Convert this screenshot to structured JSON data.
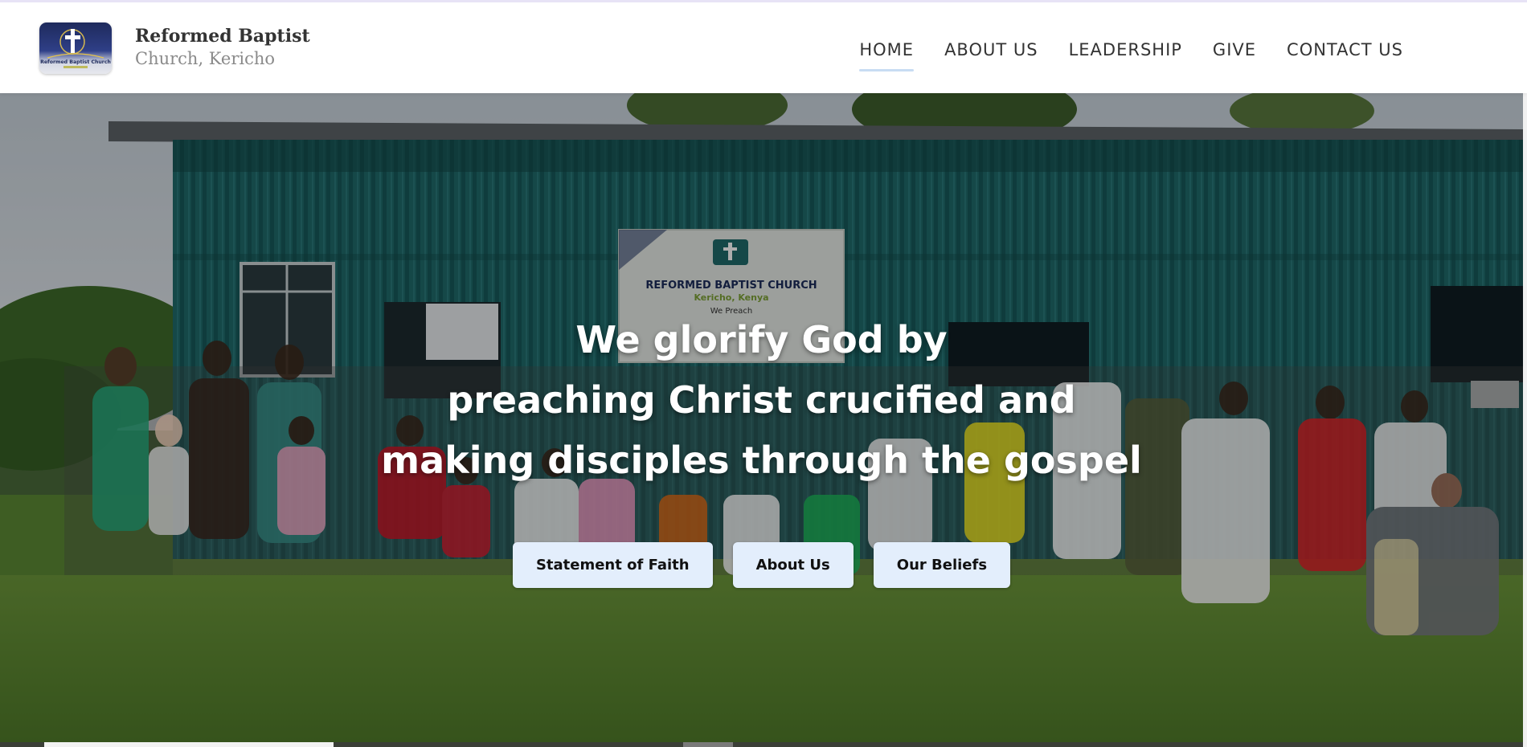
{
  "header": {
    "logo": {
      "icon": "cross-icon",
      "text": "Reformed Baptist Church"
    },
    "brand": {
      "line1": "Reformed Baptist",
      "line2": "Church, Kericho"
    },
    "nav": [
      {
        "label": "HOME",
        "active": true
      },
      {
        "label": "ABOUT US",
        "active": false
      },
      {
        "label": "LEADERSHIP",
        "active": false
      },
      {
        "label": "GIVE",
        "active": false
      },
      {
        "label": "CONTACT US",
        "active": false
      }
    ]
  },
  "hero": {
    "heading_lines": [
      "We glorify God by",
      "preaching Christ crucified and",
      "making disciples through the gospel"
    ],
    "buttons": [
      {
        "label": "Statement of Faith"
      },
      {
        "label": "About Us"
      },
      {
        "label": "Our Beliefs"
      }
    ],
    "banner": {
      "title": "REFORMED BAPTIST CHURCH",
      "subtitle": "Kericho, Kenya",
      "tagline": "We Preach"
    }
  },
  "colors": {
    "nav_text": "#333333",
    "nav_active_underline": "#c8dcf3",
    "button_bg": "#e3eefc",
    "hero_text": "#ffffff"
  }
}
